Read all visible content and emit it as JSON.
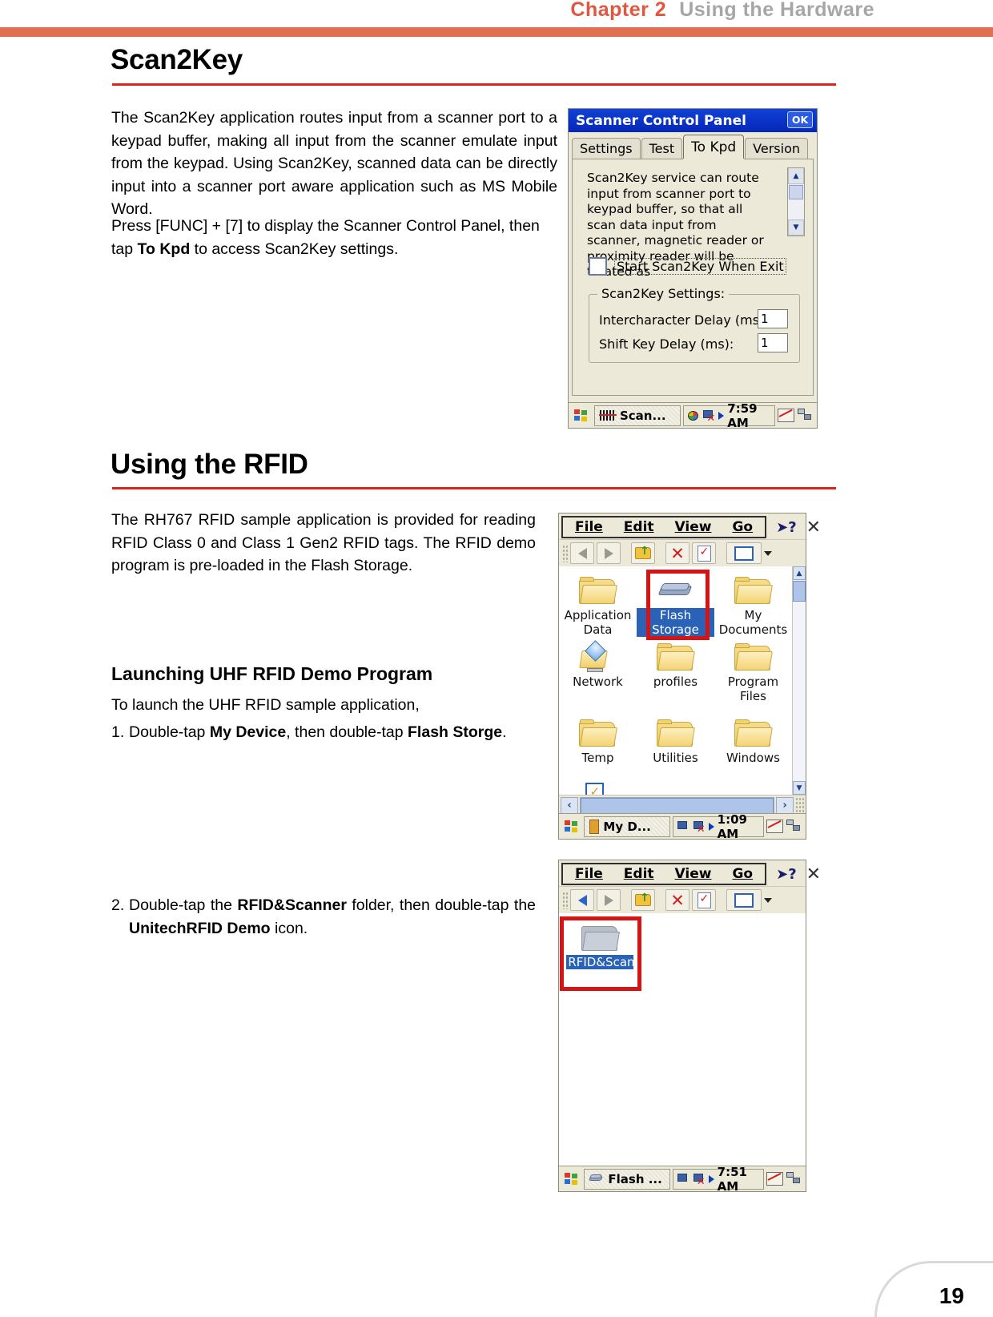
{
  "header": {
    "chapter": "Chapter 2",
    "title": "Using the Hardware"
  },
  "page_number": "19",
  "sections": [
    {
      "id": "scan2key",
      "heading": "Scan2Key",
      "paragraphs": [
        "The Scan2Key application routes input from a scanner port to a keypad buffer, making all input from the scanner emulate input from the keypad. Using Scan2Key, scanned data can be directly input into a scanner port aware application such as MS Mobile Word.",
        "Press [FUNC] + [7] to display the Scanner Control Panel, then tap "
      ],
      "para2_bold": "To Kpd",
      "para2_tail": " to access Scan2Key settings."
    },
    {
      "id": "using-rfid",
      "heading": "Using the RFID",
      "paragraph": "The RH767 RFID sample application is provided for reading RFID Class 0 and Class 1 Gen2 RFID tags. The RFID demo program is pre-loaded in the Flash Storage.",
      "subheading": "Launching UHF RFID Demo Program",
      "intro": "To launch the UHF RFID sample application,",
      "steps": [
        {
          "number": "1.",
          "parts": [
            "Double-tap ",
            "My Device",
            ", then double-tap ",
            "Flash Storge",
            "."
          ]
        },
        {
          "number": "2.",
          "parts": [
            "Double-tap the ",
            "RFID&Scanner",
            " folder, then double-tap the ",
            "UnitechRFID Demo",
            " icon."
          ]
        }
      ]
    }
  ],
  "scanner_control_panel": {
    "title": "Scanner Control Panel",
    "ok_label": "OK",
    "tabs": [
      {
        "label": "Settings",
        "active": false
      },
      {
        "label": "Test",
        "active": false
      },
      {
        "label": "To Kpd",
        "active": true
      },
      {
        "label": "Version",
        "active": false
      }
    ],
    "description": "Scan2Key service can route input from scanner port to keypad buffer, so that all scan data input from scanner, magnetic reader or proximity reader will be treated as",
    "checkbox": {
      "label": "Start Scan2Key When Exit",
      "checked": false
    },
    "group_title": "Scan2Key Settings:",
    "fields": [
      {
        "label": "Intercharacter Delay (ms):",
        "value": "1"
      },
      {
        "label": "Shift Key Delay (ms):",
        "value": "1"
      }
    ],
    "taskbar": {
      "task": "Scan...",
      "time": "7:59 AM"
    }
  },
  "explorer_mydevice": {
    "menus": [
      "File",
      "Edit",
      "View",
      "Go"
    ],
    "help_icon": "help-arrow-icon",
    "close_icon": "close-icon",
    "icons": [
      {
        "label": "Application Data",
        "type": "folder",
        "selected": false
      },
      {
        "label": "Flash Storage",
        "type": "disk",
        "selected": true
      },
      {
        "label": "My Documents",
        "type": "folder",
        "selected": false
      },
      {
        "label": "Network",
        "type": "network",
        "selected": false
      },
      {
        "label": "profiles",
        "type": "folder",
        "selected": false
      },
      {
        "label": "Program Files",
        "type": "folder",
        "selected": false
      },
      {
        "label": "Temp",
        "type": "folder",
        "selected": false
      },
      {
        "label": "Utilities",
        "type": "folder",
        "selected": false
      },
      {
        "label": "Windows",
        "type": "folder",
        "selected": false
      }
    ],
    "taskbar": {
      "task": "My D...",
      "time": "1:09 AM"
    }
  },
  "explorer_flash": {
    "menus": [
      "File",
      "Edit",
      "View",
      "Go"
    ],
    "icons": [
      {
        "label": "RFID&Scanner",
        "type": "grey-folder",
        "selected": true
      }
    ],
    "taskbar": {
      "task": "Flash ...",
      "time": "7:51 AM"
    }
  }
}
